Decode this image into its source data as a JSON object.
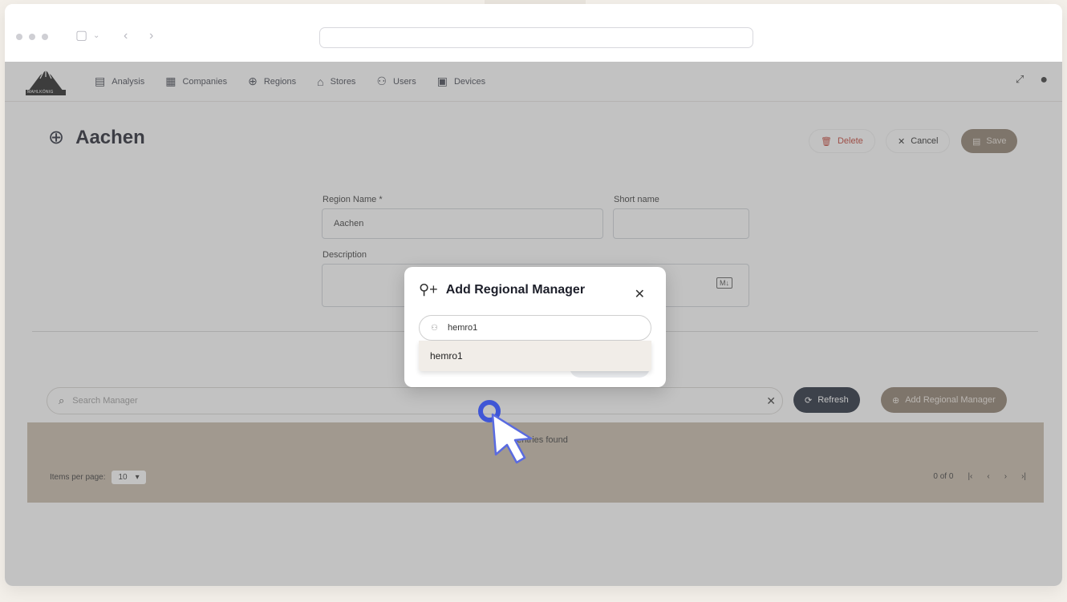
{
  "nav": {
    "logo_text": "MAHLKÖNIG",
    "items": [
      {
        "label": "Analysis",
        "icon": "analysis-icon"
      },
      {
        "label": "Companies",
        "icon": "companies-icon"
      },
      {
        "label": "Regions",
        "icon": "globe-icon"
      },
      {
        "label": "Stores",
        "icon": "store-icon"
      },
      {
        "label": "Users",
        "icon": "users-icon"
      },
      {
        "label": "Devices",
        "icon": "devices-icon"
      }
    ]
  },
  "page": {
    "title": "Aachen",
    "delete_label": "Delete",
    "cancel_label": "Cancel",
    "save_label": "Save"
  },
  "form": {
    "region_name_label": "Region Name *",
    "region_name_value": "Aachen",
    "short_name_label": "Short name",
    "short_name_value": "",
    "description_label": "Description",
    "md_badge": "M↓"
  },
  "managers": {
    "search_placeholder": "Search Manager",
    "refresh_label": "Refresh",
    "add_label": "Add Regional Manager",
    "empty_text": "No entries found",
    "items_per_page_label": "Items per page:",
    "items_per_page_value": "10",
    "range_text": "0 of 0"
  },
  "modal": {
    "title": "Add Regional Manager",
    "search_value": "hemro1",
    "option": "hemro1"
  }
}
